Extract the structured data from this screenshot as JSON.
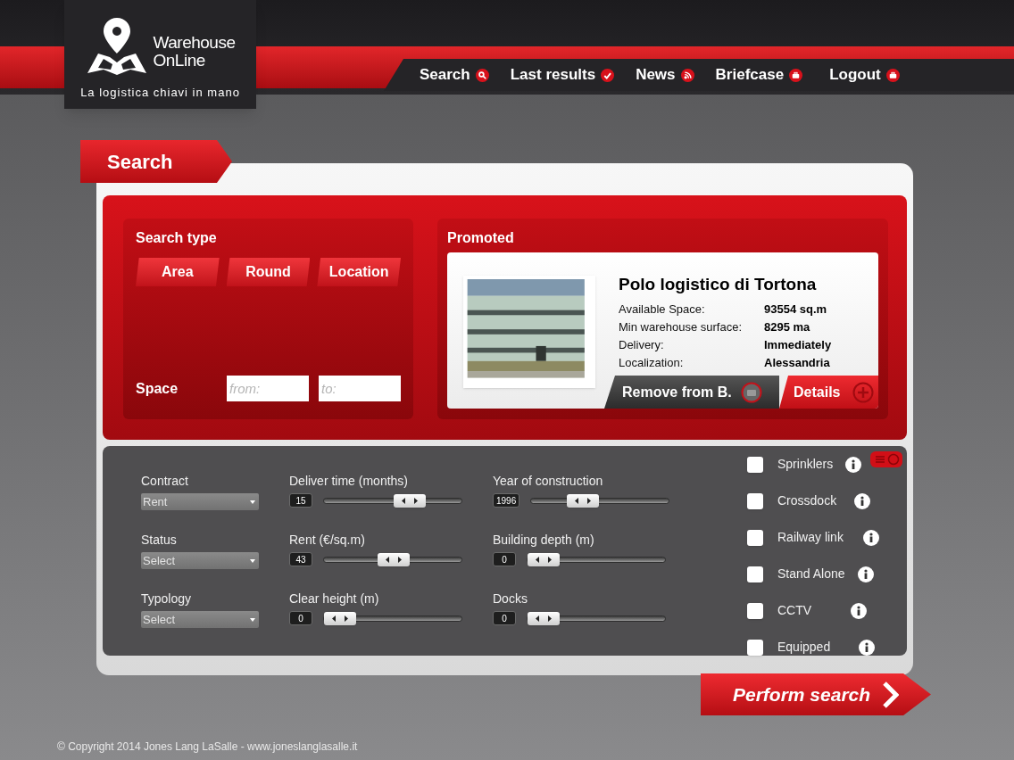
{
  "brand": {
    "line1": "Warehouse",
    "line2": "OnLine",
    "tagline": "La logistica chiavi in mano"
  },
  "nav": [
    {
      "label": "Search",
      "kind": "search"
    },
    {
      "label": "Last results",
      "kind": "check"
    },
    {
      "label": "News",
      "kind": "rss"
    },
    {
      "label": "Briefcase",
      "kind": "briefcase"
    },
    {
      "label": "Logout",
      "kind": "briefcase"
    }
  ],
  "search_tab": "Search",
  "search_type": {
    "title": "Search type",
    "options": [
      "Area",
      "Round",
      "Location"
    ]
  },
  "space": {
    "label": "Space",
    "from_placeholder": "from:",
    "to_placeholder": "to:"
  },
  "promoted": {
    "title": "Promoted",
    "name": "Polo logistico di Tortona",
    "details": [
      {
        "label": "Available Space:",
        "value": "93554 sq.m"
      },
      {
        "label": "Min warehouse surface:",
        "value": "8295 ma"
      },
      {
        "label": "Delivery:",
        "value": "Immediately"
      },
      {
        "label": "Localization:",
        "value": "Alessandria"
      }
    ],
    "buttons": [
      {
        "kind": "remove",
        "label": "Remove from B."
      },
      {
        "kind": "details",
        "label": "Details"
      }
    ]
  },
  "filters": [
    {
      "kind": "select",
      "label": "Contract",
      "value": "Rent",
      "disabled": true
    },
    {
      "kind": "slider",
      "label": "Deliver time (months)",
      "reading": "15",
      "level": 0.65
    },
    {
      "kind": "slider",
      "label": "Year of construction",
      "reading": "1996",
      "level": 0.33
    },
    {
      "kind": "select",
      "label": "Status",
      "value": "Select",
      "disabled": true
    },
    {
      "kind": "slider",
      "label": "Rent (€/sq.m)",
      "reading": "43",
      "level": 0.5
    },
    {
      "kind": "slider",
      "label": "Building depth (m)",
      "reading": "0",
      "level": 0
    },
    {
      "kind": "select",
      "label": "Typology",
      "value": "Select",
      "disabled": true
    },
    {
      "kind": "slider",
      "label": "Clear height (m)",
      "reading": "0",
      "level": 0
    },
    {
      "kind": "slider",
      "label": "Docks",
      "reading": "0",
      "level": 0
    }
  ],
  "features": [
    {
      "label": "Sprinklers",
      "checked": false
    },
    {
      "label": "Crossdock",
      "checked": false
    },
    {
      "label": "Railway link",
      "checked": false
    },
    {
      "label": "Stand Alone",
      "checked": false
    },
    {
      "label": "CCTV",
      "checked": false
    },
    {
      "label": "Equipped",
      "checked": false
    }
  ],
  "perform_button": "Perform search",
  "footer": "© Copyright 2014 Jones Lang LaSalle - www.joneslanglasalle.it"
}
